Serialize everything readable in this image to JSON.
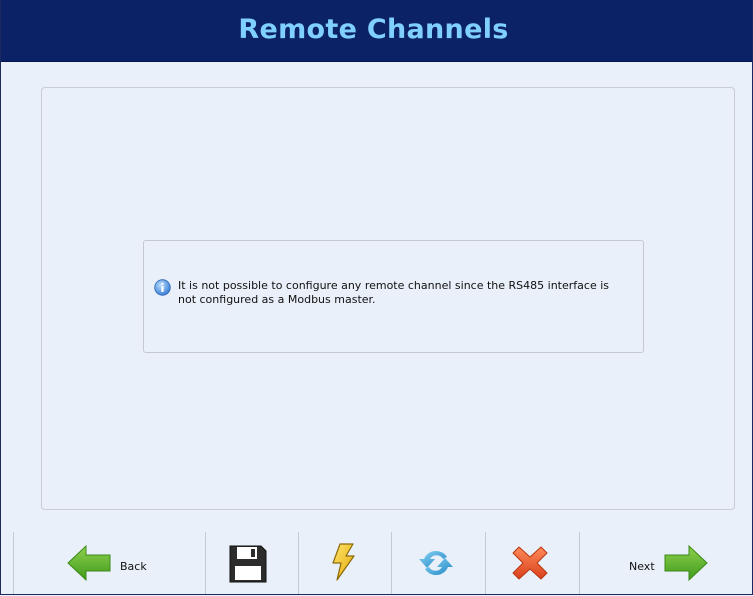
{
  "header": {
    "title": "Remote Channels"
  },
  "message": {
    "icon": "info-icon",
    "text": "It is not possible to configure any remote channel since the RS485 interface is not configured as a Modbus master."
  },
  "toolbar": {
    "back_label": "Back",
    "next_label": "Next",
    "icons": [
      "back-arrow-icon",
      "save-disk-icon",
      "lightning-icon",
      "refresh-icon",
      "close-x-icon",
      "next-arrow-icon"
    ]
  },
  "colors": {
    "header_bg": "#0c2266",
    "header_text": "#7fd0ff",
    "page_bg": "#e9f0f9",
    "arrow_green": "#5bb52a",
    "cancel_red": "#e4552a",
    "refresh_blue": "#3aa3d6",
    "bolt_yellow": "#f3c21b"
  }
}
